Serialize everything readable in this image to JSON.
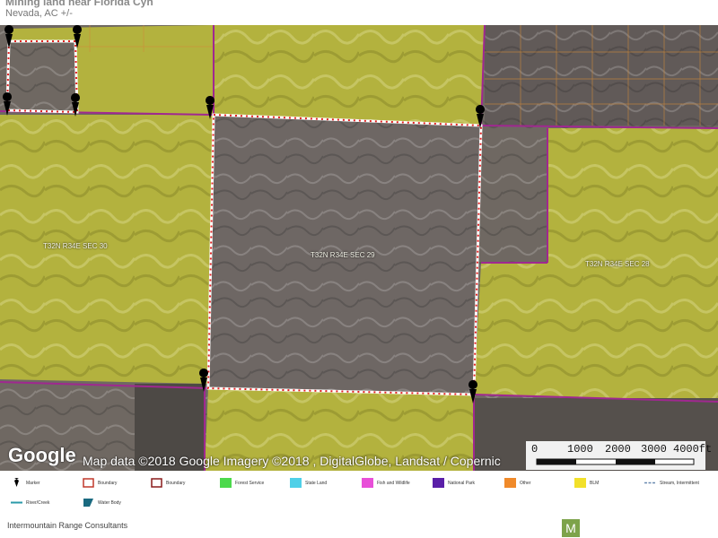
{
  "header": {
    "title": "Mining land near Florida Cyn",
    "subtitle": "Nevada,  AC +/-"
  },
  "map": {
    "google_logo": "Google",
    "attribution": "Map data ©2018 Google  Imagery ©2018 , DigitalGlobe, Landsat / Copernic",
    "section_labels": [
      {
        "id": "left",
        "text": "T32N R34E SEC 30"
      },
      {
        "id": "center",
        "text": "T32N R34E SEC 29"
      },
      {
        "id": "right",
        "text": "T32N R34E SEC 28"
      }
    ],
    "scale": [
      "0",
      "1000",
      "2000",
      "3000",
      "4000ft"
    ],
    "colors": {
      "blm": "#b8b640",
      "private": "#6e6660",
      "boundary_pink": "#a0288c",
      "parcel_boundary": "#ffffff",
      "parcel_dots": "#e02020",
      "marker": "#000000"
    }
  },
  "legend": {
    "items": [
      {
        "label": "Marker",
        "icon": "marker-icon",
        "color": "#000000"
      },
      {
        "label": "Boundary",
        "icon": "boundary-icon",
        "color": "#c0392b"
      },
      {
        "label": "Boundary",
        "icon": "boundary-icon",
        "color": "#8a1c1c"
      },
      {
        "label": "Forest Service",
        "icon": "forest-service-icon",
        "color": "#4cd94c"
      },
      {
        "label": "State Land",
        "icon": "state-land-icon",
        "color": "#4fd0e8"
      },
      {
        "label": "Fish and Wildlife",
        "icon": "fish-wildlife-icon",
        "color": "#e84fd8"
      },
      {
        "label": "National Park",
        "icon": "national-park-icon",
        "color": "#5a1fa8"
      },
      {
        "label": "Other",
        "icon": "other-icon",
        "color": "#f08a2a"
      },
      {
        "label": "BLM",
        "icon": "blm-icon",
        "color": "#f2e02a"
      },
      {
        "label": "Stream, Intermittent",
        "icon": "stream-icon",
        "color": "#6a8ab0"
      },
      {
        "label": "River/Creek",
        "icon": "river-icon",
        "color": "#2a9aa8"
      },
      {
        "label": "Water Body",
        "icon": "water-body-icon",
        "color": "#1a6a80"
      }
    ]
  },
  "footer": {
    "company": "Intermountain Range  Consultants"
  }
}
